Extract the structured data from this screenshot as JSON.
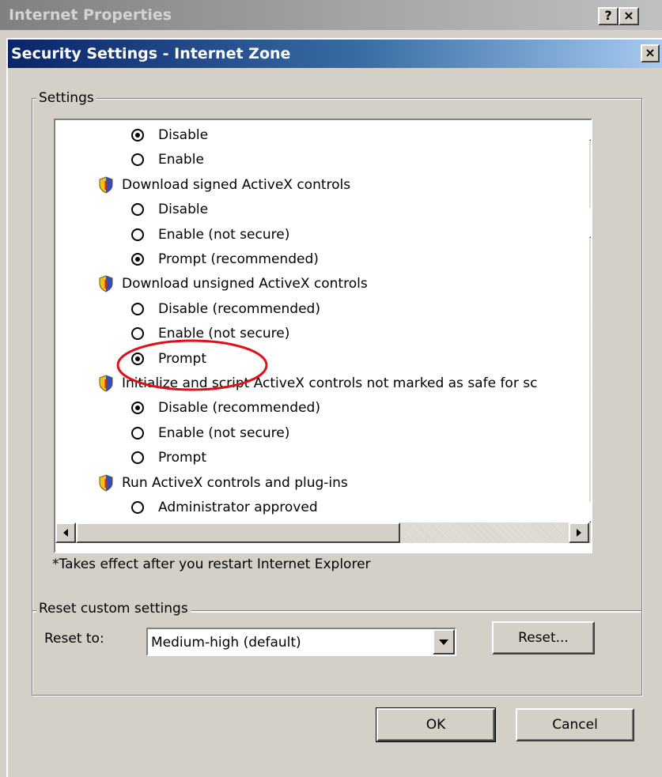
{
  "colors": {
    "title_active": "#0a246a",
    "title_inactive": "#808080",
    "face": "#d4d0c8",
    "annotation": "#e0101a"
  },
  "parent_window": {
    "title": "Internet Properties",
    "help_label": "?",
    "close_label": "×"
  },
  "dialog": {
    "title": "Security Settings - Internet Zone",
    "close_label": "×"
  },
  "settings_group": {
    "legend": "Settings",
    "rows": [
      {
        "kind": "option",
        "label": "Disable",
        "selected": true
      },
      {
        "kind": "option",
        "label": "Enable",
        "selected": false
      },
      {
        "kind": "category",
        "label": "Download signed ActiveX controls",
        "icon": "security-shield-icon"
      },
      {
        "kind": "option",
        "label": "Disable",
        "selected": false
      },
      {
        "kind": "option",
        "label": "Enable (not secure)",
        "selected": false
      },
      {
        "kind": "option",
        "label": "Prompt (recommended)",
        "selected": true
      },
      {
        "kind": "category",
        "label": "Download unsigned ActiveX controls",
        "icon": "security-shield-icon"
      },
      {
        "kind": "option",
        "label": "Disable (recommended)",
        "selected": false
      },
      {
        "kind": "option",
        "label": "Enable (not secure)",
        "selected": false
      },
      {
        "kind": "option",
        "label": "Prompt",
        "selected": true
      },
      {
        "kind": "category",
        "label": "Initialize and script ActiveX controls not marked as safe for sc",
        "icon": "security-shield-icon"
      },
      {
        "kind": "option",
        "label": "Disable (recommended)",
        "selected": true
      },
      {
        "kind": "option",
        "label": "Enable (not secure)",
        "selected": false
      },
      {
        "kind": "option",
        "label": "Prompt",
        "selected": false
      },
      {
        "kind": "category",
        "label": "Run ActiveX controls and plug-ins",
        "icon": "security-shield-icon"
      },
      {
        "kind": "option",
        "label": "Administrator approved",
        "selected": false
      }
    ],
    "note": "*Takes effect after you restart Internet Explorer"
  },
  "reset_group": {
    "legend": "Reset custom settings",
    "reset_to_label": "Reset to:",
    "selected_level": "Medium-high (default)",
    "reset_button": "Reset..."
  },
  "footer": {
    "ok_label": "OK",
    "cancel_label": "Cancel"
  }
}
